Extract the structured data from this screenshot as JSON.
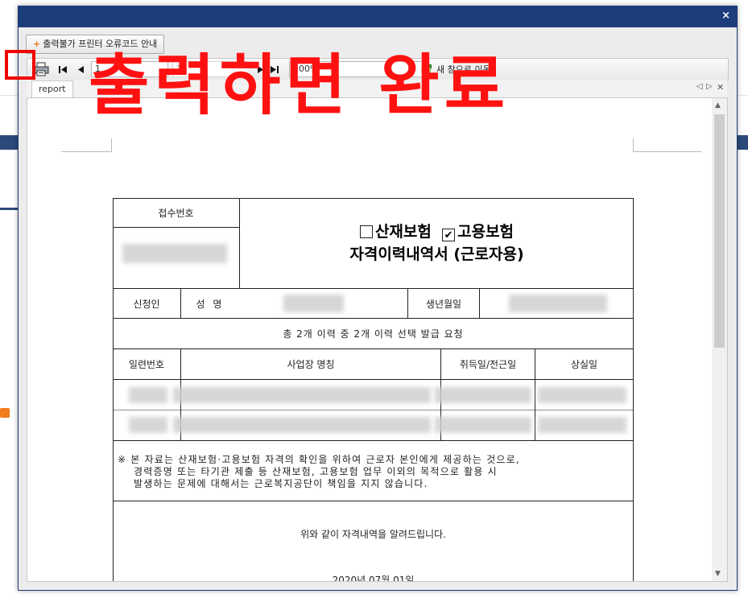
{
  "dialog": {
    "close_label": "×"
  },
  "toolbar": {
    "guide_button_label": "출력불가 프린터 오류코드 안내",
    "page_current": "1",
    "page_total": "1",
    "zoom": "100%",
    "move_label": "새 창으로 이동"
  },
  "tab": {
    "label": "report"
  },
  "annotation": {
    "text": "출력하면 완료"
  },
  "form": {
    "receipt_label": "접수번호",
    "title_option1": "산재보험",
    "title_option2": "고용보험",
    "check_mark": "✔",
    "title_line2": "자격이력내역서 (근로자용)",
    "applicant_label": "신청인",
    "name_label": "성 명",
    "birth_label": "생년월일",
    "history_summary": "총 2개 이력 중 2개 이력 선택 발급 요청",
    "col_serial": "일련번호",
    "col_workplace": "사업장 명칭",
    "col_acquire": "취득일/전근일",
    "col_loss": "상실일",
    "notice_line1": "※ 본 자료는 산재보험·고용보험 자격의 확인을 위하여 근로자 본인에게 제공하는 것으로,",
    "notice_line2": "경력증명 또는 타기관 제출 등 산재보험, 고용보험 업무 이외의 목적으로 활용 시",
    "notice_line3": "발생하는 문제에 대해서는 근로복지공단이 책임을 지지 않습니다.",
    "confirm_text": "위와 같이 자격내역을 알려드립니다.",
    "date": "2020년 07월 01일"
  },
  "colors": {
    "titlebar": "#1d3c7c",
    "annotation": "#ff1111",
    "highlight_box": "#f00000"
  },
  "icons": [
    "printer-icon",
    "first-page-icon",
    "prev-page-icon",
    "next-page-icon",
    "last-page-icon",
    "dropdown-icon",
    "new-window-icon",
    "close-icon"
  ]
}
